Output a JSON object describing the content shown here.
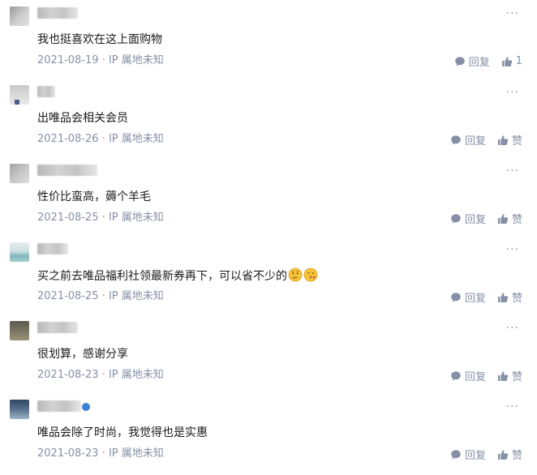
{
  "comments": [
    {
      "text": "我也挺喜欢在这上面购物",
      "date": "2021-08-19",
      "location": "IP 属地未知",
      "reply_label": "回复",
      "like_label": "1"
    },
    {
      "text": "出唯品会相关会员",
      "date": "2021-08-26",
      "location": "IP 属地未知",
      "reply_label": "回复",
      "like_label": "赞"
    },
    {
      "text": "性价比蛮高，薅个羊毛",
      "date": "2021-08-25",
      "location": "IP 属地未知",
      "reply_label": "回复",
      "like_label": "赞"
    },
    {
      "text": "买之前去唯品福利社领最新券再下，可以省不少的",
      "date": "2021-08-25",
      "location": "IP 属地未知",
      "reply_label": "回复",
      "like_label": "赞"
    },
    {
      "text": "很划算，感谢分享",
      "date": "2021-08-23",
      "location": "IP 属地未知",
      "reply_label": "回复",
      "like_label": "赞"
    },
    {
      "text": "唯品会除了时尚，我觉得也是实惠",
      "date": "2021-08-23",
      "location": "IP 属地未知",
      "reply_label": "回复",
      "like_label": "赞"
    }
  ],
  "meta_separator": " · ",
  "more_glyph": "···",
  "colors": {
    "meta": "#8590a6",
    "text": "#1a1a1a",
    "more": "#9a9a9a"
  },
  "icons": {
    "reply": "comment-bubble-icon",
    "like": "thumbs-up-icon",
    "more": "more-dots-icon",
    "emoji_1": "thinking-face-emoji",
    "emoji_2": "kissing-face-emoji"
  }
}
